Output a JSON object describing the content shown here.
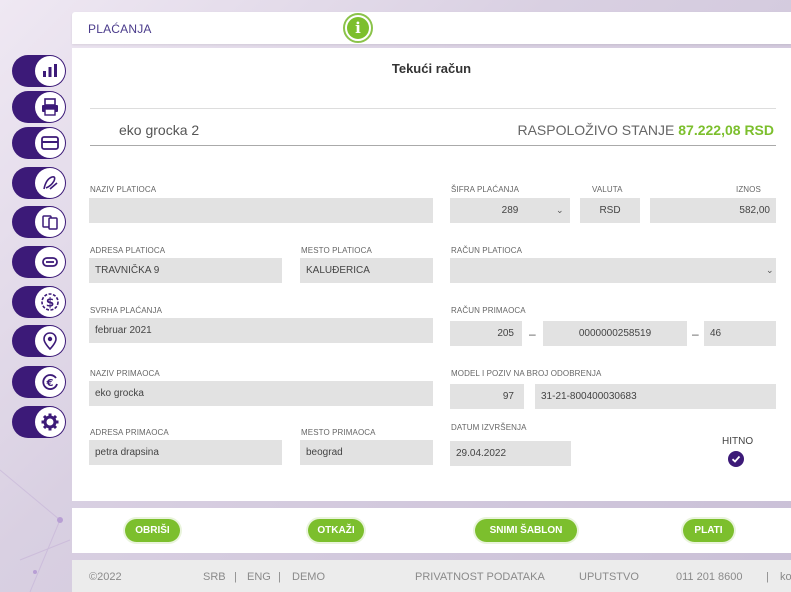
{
  "header": {
    "title": "PLAĆANJA",
    "info_symbol": "i"
  },
  "nav": {
    "items": [
      {
        "icon": "bar-chart-icon"
      },
      {
        "icon": "printer-icon"
      },
      {
        "icon": "card-icon"
      },
      {
        "icon": "sign-pen-icon"
      },
      {
        "icon": "transfer-docs-icon"
      },
      {
        "icon": "exchange-arrows-icon"
      },
      {
        "icon": "dollar-coin-icon"
      },
      {
        "icon": "location-pin-icon"
      },
      {
        "icon": "euro-exchange-icon"
      },
      {
        "icon": "settings-gear-icon"
      }
    ]
  },
  "page": {
    "title": "Tekući račun"
  },
  "account": {
    "name": "eko grocka 2",
    "balance_label": "RASPOLOŽIVO STANJE",
    "balance_value": "87.222,08 RSD"
  },
  "form": {
    "payer_name": {
      "label": "NAZIV PLATIOCA",
      "value": ""
    },
    "payer_address": {
      "label": "ADRESA PLATIOCA",
      "value": "TRAVNIČKA 9"
    },
    "payer_city": {
      "label": "MESTO PLATIOCA",
      "value": "KALUĐERICA"
    },
    "purpose": {
      "label": "SVRHA PLAĆANJA",
      "value": "februar 2021"
    },
    "recipient_name": {
      "label": "NAZIV PRIMAOCA",
      "value": "eko grocka"
    },
    "recipient_address": {
      "label": "ADRESA PRIMAOCA",
      "value": "petra drapsina"
    },
    "recipient_city": {
      "label": "MESTO PRIMAOCA",
      "value": "beograd"
    },
    "payment_code": {
      "label": "ŠIFRA PLAĆANJA",
      "value": "289"
    },
    "currency": {
      "label": "VALUTA",
      "value": "RSD"
    },
    "amount": {
      "label": "IZNOS",
      "value": "582,00"
    },
    "payer_account": {
      "label": "RAČUN PLATIOCA",
      "value": ""
    },
    "recipient_account": {
      "label": "RAČUN PRIMAOCA",
      "part1": "205",
      "part2": "0000000258519",
      "part3": "46",
      "separator": "–"
    },
    "model_reference": {
      "label": "MODEL I POZIV NA BROJ ODOBRENJA",
      "model": "97",
      "reference": "31-21-800400030683"
    },
    "execution_date": {
      "label": "DATUM IZVRŠENJA",
      "value": "29.04.2022"
    },
    "urgent": {
      "label": "HITNO",
      "checked": true
    }
  },
  "buttons": {
    "delete": "OBRIŠI",
    "cancel": "OTKAŽI",
    "save_template": "SNIMI ŠABLON",
    "pay": "PLATI"
  },
  "footer": {
    "copyright": "©2022",
    "lang_srb": "SRB",
    "lang_eng": "ENG",
    "demo": "DEMO",
    "sep": "|",
    "privacy": "PRIVATNOST PODATAKA",
    "manual": "UPUTSTVO",
    "phone": "011 201 8600",
    "contact": "ko"
  },
  "colors": {
    "brand_purple": "#3c1a78",
    "accent_green": "#7cbf2d",
    "field_bg": "#e2e2e2"
  }
}
